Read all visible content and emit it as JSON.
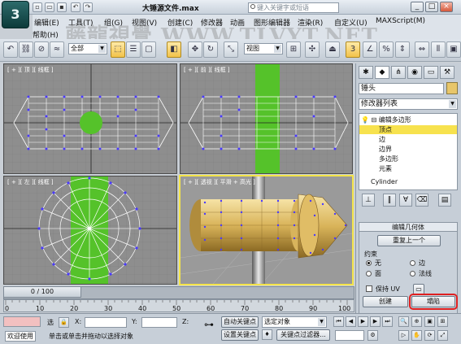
{
  "titlebar": {
    "logo": "3",
    "doc_title": "大锤源文件.max",
    "search_placeholder": "键入关键字或短语",
    "controls": [
      "_",
      "□",
      "×"
    ]
  },
  "watermark": "藤龍視覺 WWW.TLVYT.NET",
  "menu": [
    "编辑(E)",
    "工具(T)",
    "组(G)",
    "视图(V)",
    "创建(C)",
    "修改器",
    "动画",
    "图形编辑器",
    "渲染(R)",
    "自定义(U)",
    "MAXScript(M)",
    "帮助(H)"
  ],
  "toolbar": {
    "selection_filter": "全部",
    "reference_coord": "视图",
    "icons": [
      "undo-icon",
      "redo-icon",
      "link-icon",
      "unlink-icon",
      "bind-icon",
      "select-icon",
      "select-by-name-icon",
      "region-icon",
      "window-icon",
      "move-icon",
      "rotate-icon",
      "scale-icon",
      "pivot-icon",
      "snap-icon",
      "angle-snap-icon",
      "percent-snap-icon",
      "mirror-icon",
      "align-icon",
      "render-icon"
    ]
  },
  "viewports": {
    "top": "[ + ][ 顶 ][ 线框 ]",
    "front": "[ + ][ 前 ][ 线框 ]",
    "left": "[ + ][ 左 ][ 线框 ]",
    "persp": "[ + ][ 透视 ][ 平滑 + 高光 ]"
  },
  "panel": {
    "object_name": "锤头",
    "modifier_list": "修改器列表",
    "stack": [
      {
        "label": "编辑多边形",
        "indent": 0,
        "selected": false
      },
      {
        "label": "顶点",
        "indent": 1,
        "selected": true
      },
      {
        "label": "边",
        "indent": 1,
        "selected": false
      },
      {
        "label": "边界",
        "indent": 1,
        "selected": false
      },
      {
        "label": "多边形",
        "indent": 1,
        "selected": false
      },
      {
        "label": "元素",
        "indent": 1,
        "selected": false
      },
      {
        "label": "Cylinder",
        "indent": 0,
        "selected": false
      }
    ],
    "rollout_title": "编辑几何体",
    "repeat_last": "重复上一个",
    "constraints_label": "约束",
    "constraint_none": "无",
    "constraint_edge": "边",
    "constraint_face": "面",
    "constraint_normal": "法线",
    "preserve_uv": "保持 UV",
    "create_btn": "创建",
    "collapse_btn": "塌陷",
    "more": "..."
  },
  "timeline": {
    "slider": "0 / 100",
    "ticks": [
      "0",
      "10",
      "20",
      "30",
      "40",
      "50",
      "60",
      "70",
      "80",
      "90",
      "100"
    ]
  },
  "status": {
    "left_label": "欢迎使用",
    "sel_label": "选",
    "x": "X:",
    "y": "Y:",
    "z": "Z:",
    "prompt": "单击或单击并拖动以选择对象",
    "autokey": "自动关键点",
    "setkey": "设置关键点",
    "selected_obj": "选定对象",
    "key_filters": "关键点过滤器..."
  }
}
